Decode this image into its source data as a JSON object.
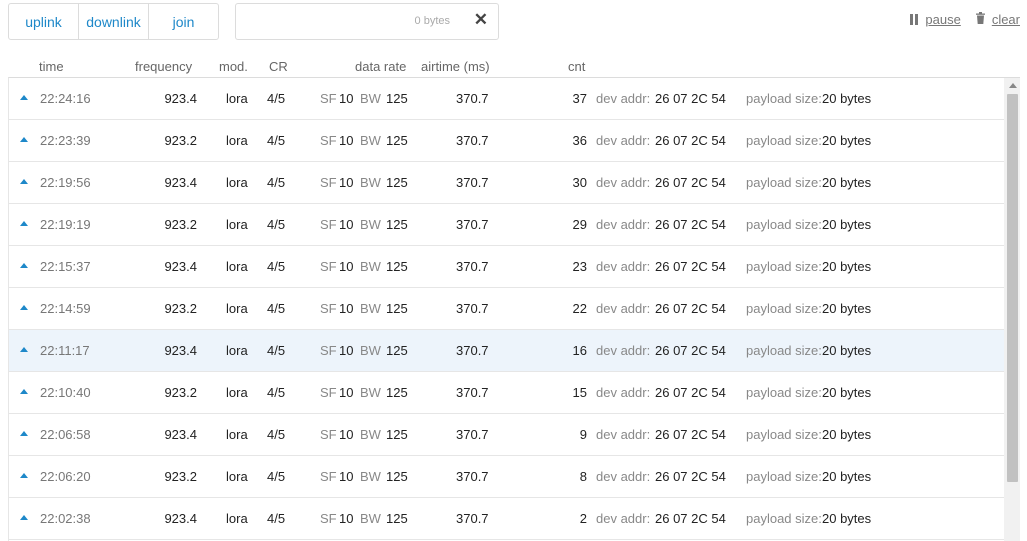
{
  "toolbar": {
    "filters": [
      "uplink",
      "downlink",
      "join"
    ],
    "search": {
      "value": "",
      "placeholder": ""
    },
    "byte_count": "0 bytes",
    "clear_search_glyph": "✕",
    "pause_label": "pause",
    "clear_label": "clear"
  },
  "icons": {
    "pause": "pause-icon",
    "clear": "trash-icon",
    "uplink_row": "uplink-arrow-icon",
    "clear_search": "close-icon"
  },
  "table": {
    "columns": {
      "time": "time",
      "frequency": "frequency",
      "mod": "mod.",
      "cr": "CR",
      "data_rate": "data rate",
      "airtime": "airtime (ms)",
      "cnt": "cnt"
    },
    "labels": {
      "sf": "SF",
      "bw": "BW",
      "dev_addr": "dev addr:",
      "payload_size": "payload size:"
    },
    "selected_row_index": 6,
    "rows": [
      {
        "time": "22:24:16",
        "frequency": "923.4",
        "mod": "lora",
        "cr": "4/5",
        "sf": "10",
        "bw": "125",
        "airtime": "370.7",
        "cnt": "37",
        "dev_addr": "26 07 2C 54",
        "payload_size": "20 bytes"
      },
      {
        "time": "22:23:39",
        "frequency": "923.2",
        "mod": "lora",
        "cr": "4/5",
        "sf": "10",
        "bw": "125",
        "airtime": "370.7",
        "cnt": "36",
        "dev_addr": "26 07 2C 54",
        "payload_size": "20 bytes"
      },
      {
        "time": "22:19:56",
        "frequency": "923.4",
        "mod": "lora",
        "cr": "4/5",
        "sf": "10",
        "bw": "125",
        "airtime": "370.7",
        "cnt": "30",
        "dev_addr": "26 07 2C 54",
        "payload_size": "20 bytes"
      },
      {
        "time": "22:19:19",
        "frequency": "923.2",
        "mod": "lora",
        "cr": "4/5",
        "sf": "10",
        "bw": "125",
        "airtime": "370.7",
        "cnt": "29",
        "dev_addr": "26 07 2C 54",
        "payload_size": "20 bytes"
      },
      {
        "time": "22:15:37",
        "frequency": "923.4",
        "mod": "lora",
        "cr": "4/5",
        "sf": "10",
        "bw": "125",
        "airtime": "370.7",
        "cnt": "23",
        "dev_addr": "26 07 2C 54",
        "payload_size": "20 bytes"
      },
      {
        "time": "22:14:59",
        "frequency": "923.2",
        "mod": "lora",
        "cr": "4/5",
        "sf": "10",
        "bw": "125",
        "airtime": "370.7",
        "cnt": "22",
        "dev_addr": "26 07 2C 54",
        "payload_size": "20 bytes"
      },
      {
        "time": "22:11:17",
        "frequency": "923.4",
        "mod": "lora",
        "cr": "4/5",
        "sf": "10",
        "bw": "125",
        "airtime": "370.7",
        "cnt": "16",
        "dev_addr": "26 07 2C 54",
        "payload_size": "20 bytes"
      },
      {
        "time": "22:10:40",
        "frequency": "923.2",
        "mod": "lora",
        "cr": "4/5",
        "sf": "10",
        "bw": "125",
        "airtime": "370.7",
        "cnt": "15",
        "dev_addr": "26 07 2C 54",
        "payload_size": "20 bytes"
      },
      {
        "time": "22:06:58",
        "frequency": "923.4",
        "mod": "lora",
        "cr": "4/5",
        "sf": "10",
        "bw": "125",
        "airtime": "370.7",
        "cnt": "9",
        "dev_addr": "26 07 2C 54",
        "payload_size": "20 bytes"
      },
      {
        "time": "22:06:20",
        "frequency": "923.2",
        "mod": "lora",
        "cr": "4/5",
        "sf": "10",
        "bw": "125",
        "airtime": "370.7",
        "cnt": "8",
        "dev_addr": "26 07 2C 54",
        "payload_size": "20 bytes"
      },
      {
        "time": "22:02:38",
        "frequency": "923.4",
        "mod": "lora",
        "cr": "4/5",
        "sf": "10",
        "bw": "125",
        "airtime": "370.7",
        "cnt": "2",
        "dev_addr": "26 07 2C 54",
        "payload_size": "20 bytes"
      }
    ]
  },
  "colors": {
    "accent": "#1e88c9",
    "selected_row": "#edf4fb",
    "label_gray": "#888888"
  }
}
